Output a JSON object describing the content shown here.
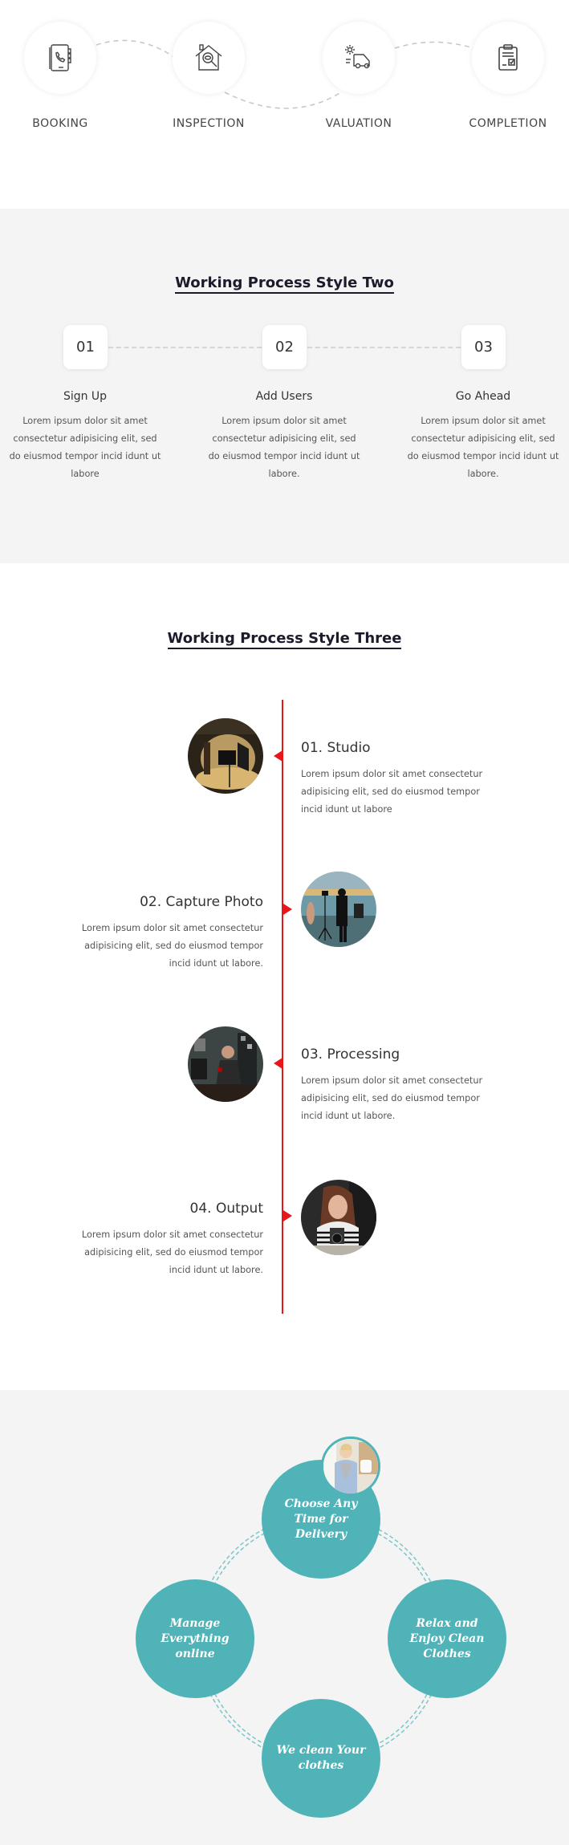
{
  "process_one": {
    "steps": [
      {
        "label": "BOOKING",
        "icon": "phone-book-icon"
      },
      {
        "label": "INSPECTION",
        "icon": "house-inspection-icon"
      },
      {
        "label": "VALUATION",
        "icon": "car-valuation-icon"
      },
      {
        "label": "COMPLETION",
        "icon": "clipboard-check-icon"
      }
    ]
  },
  "process_two": {
    "title": "Working Process Style Two",
    "steps": [
      {
        "number": "01",
        "title": "Sign Up",
        "text": "Lorem ipsum dolor sit amet consectetur adipisicing elit, sed do eiusmod tempor incid idunt ut labore"
      },
      {
        "number": "02",
        "title": "Add Users",
        "text": "Lorem ipsum dolor sit amet consectetur adipisicing elit, sed do eiusmod tempor incid idunt ut labore."
      },
      {
        "number": "03",
        "title": "Go Ahead",
        "text": "Lorem ipsum dolor sit amet consectetur adipisicing elit, sed do eiusmod tempor incid idunt ut labore."
      }
    ]
  },
  "process_three": {
    "title": "Working Process Style Three",
    "accent_color": "#e8151b",
    "steps": [
      {
        "title": "01. Studio",
        "text": "Lorem ipsum dolor sit amet consectetur adipisicing elit, sed do eiusmod tempor incid idunt ut labore",
        "image": "photo-studio"
      },
      {
        "title": "02. Capture Photo",
        "text": "Lorem ipsum dolor sit amet consectetur adipisicing elit, sed do eiusmod tempor incid idunt ut labore.",
        "image": "photographer-on-beach"
      },
      {
        "title": "03. Processing",
        "text": "Lorem ipsum dolor sit amet consectetur adipisicing elit, sed do eiusmod tempor incid idunt ut labore.",
        "image": "man-editing-photos"
      },
      {
        "title": "04. Output",
        "text": "Lorem ipsum dolor sit amet consectetur adipisicing elit, sed do eiusmod tempor incid idunt ut labore.",
        "image": "woman-with-camera"
      }
    ]
  },
  "process_four": {
    "accent_color": "#4fb3b8",
    "steps": [
      {
        "label": "Choose Any Time for Delivery"
      },
      {
        "label": "Relax and Enjoy Clean Clothes"
      },
      {
        "label": "We clean Your clothes"
      },
      {
        "label": "Manage Everything online"
      }
    ],
    "image": "delivery-woman-photo"
  }
}
